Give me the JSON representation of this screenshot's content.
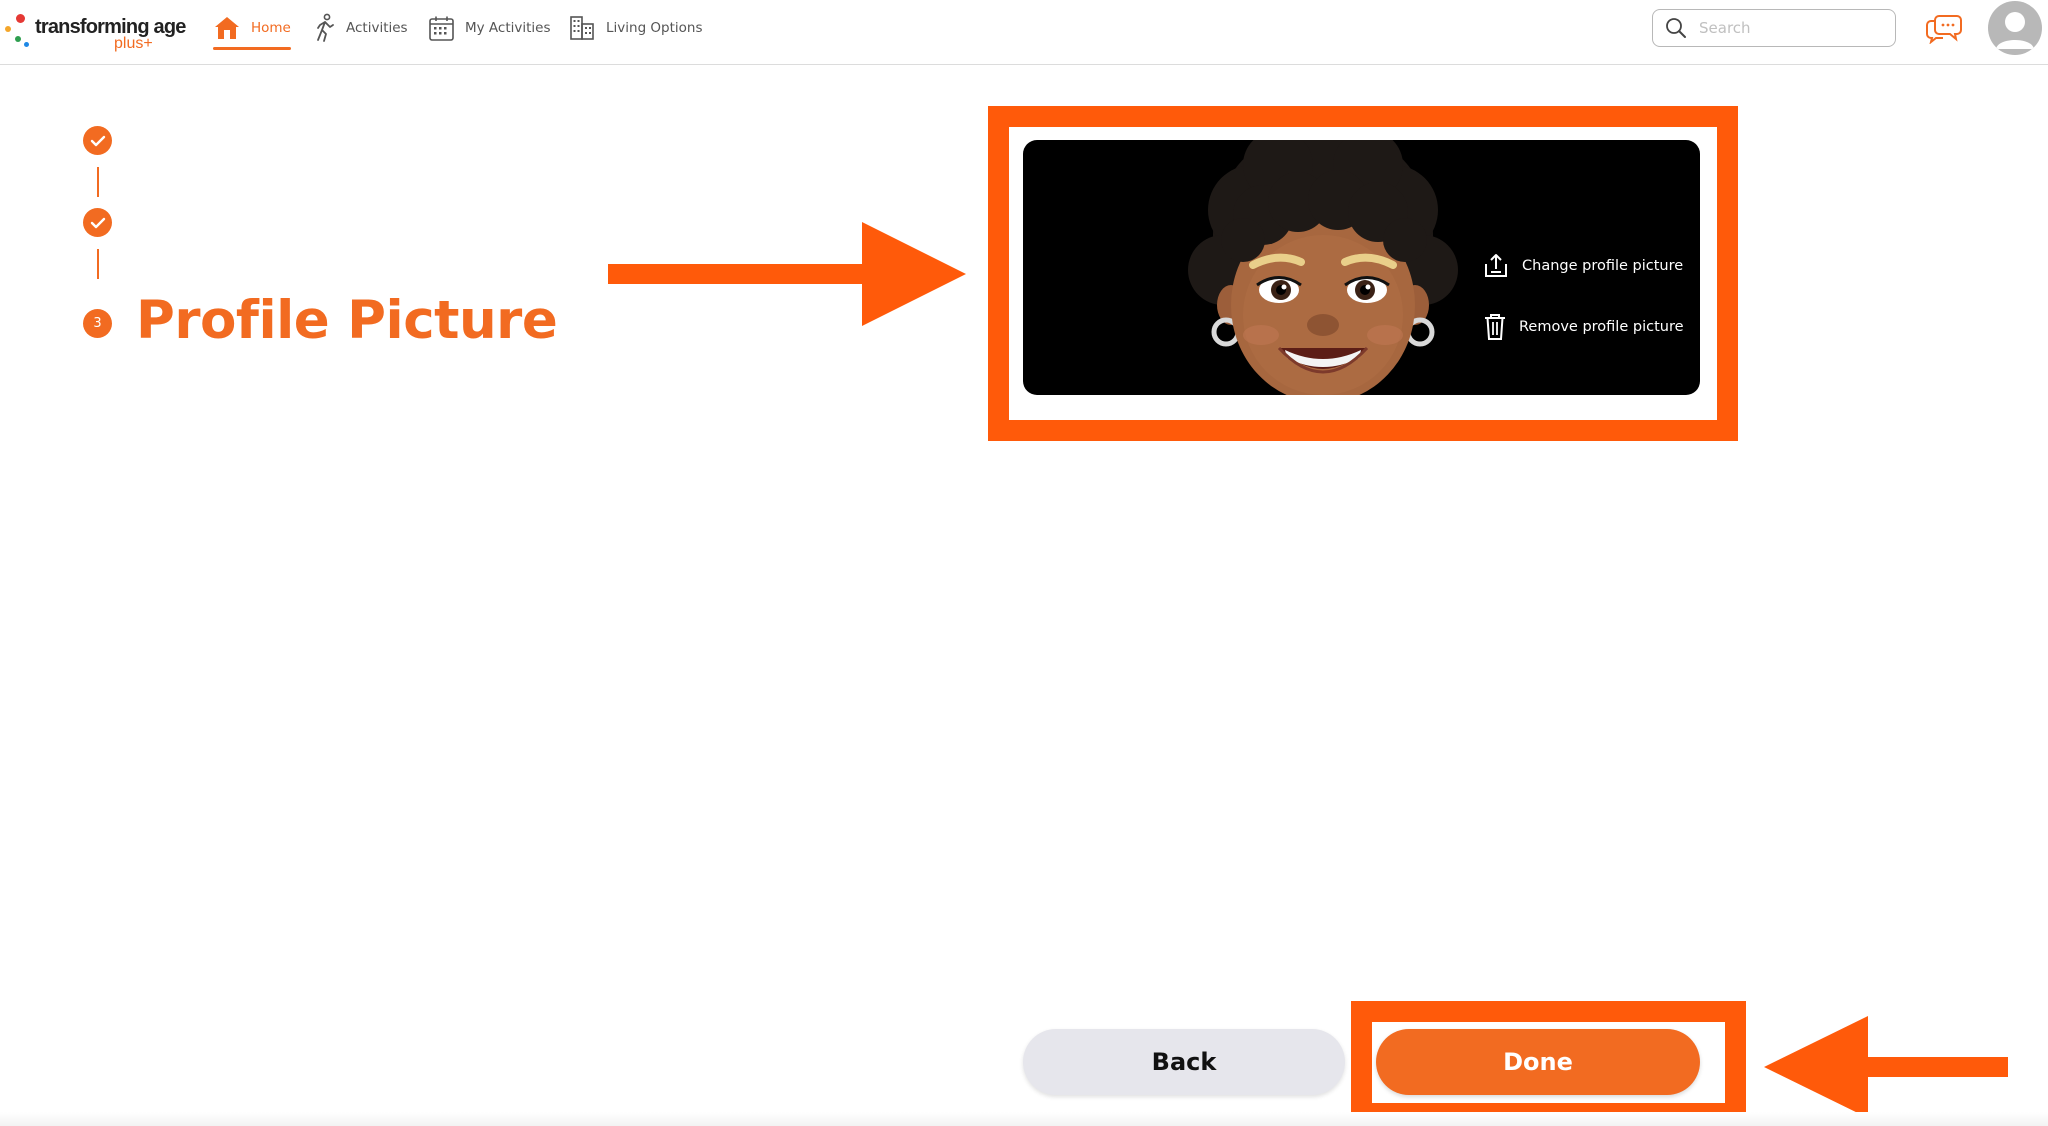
{
  "app": {
    "logo_main": "transforming age",
    "logo_sub": "plus+"
  },
  "nav": {
    "items": [
      {
        "label": "Home",
        "icon": "home-icon",
        "active": true
      },
      {
        "label": "Activities",
        "icon": "running-figure-icon",
        "active": false
      },
      {
        "label": "My Activities",
        "icon": "calendar-icon",
        "active": false
      },
      {
        "label": "Living Options",
        "icon": "buildings-icon",
        "active": false
      }
    ]
  },
  "search": {
    "placeholder": "Search",
    "value": ""
  },
  "stepper": {
    "steps": [
      {
        "state": "complete",
        "icon": "checkmark-icon"
      },
      {
        "state": "complete",
        "icon": "checkmark-icon"
      },
      {
        "state": "current",
        "number": "3",
        "title": "Profile Picture"
      }
    ]
  },
  "profile_picture": {
    "image": "memoji-avatar",
    "change_label": "Change profile picture",
    "change_icon": "upload-icon",
    "remove_label": "Remove profile picture",
    "remove_icon": "trash-icon"
  },
  "actions": {
    "back_label": "Back",
    "done_label": "Done"
  },
  "colors": {
    "brand_orange": "#f26b21",
    "annotation_orange": "#ff5a0a",
    "back_button_bg": "#e6e6ec",
    "card_bg": "#000000"
  }
}
